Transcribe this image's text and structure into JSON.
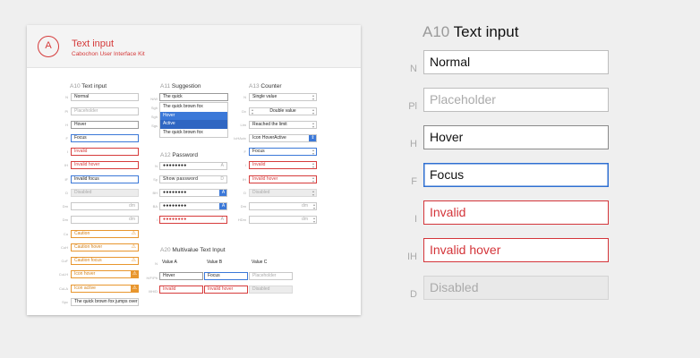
{
  "card": {
    "logo_letter": "A",
    "title": "Text input",
    "subtitle": "Cabochon User Interface Kit"
  },
  "a10": {
    "code": "A10",
    "title": "Text input",
    "rows": [
      {
        "label": "N",
        "value": "Normal",
        "state": "normal"
      },
      {
        "label": "Pl",
        "value": "Placeholder",
        "state": "ph"
      },
      {
        "label": "H",
        "value": "Hover",
        "state": "hover"
      },
      {
        "label": "F",
        "value": "Focus",
        "state": "focus"
      },
      {
        "label": "I",
        "value": "Invalid",
        "state": "invalid"
      },
      {
        "label": "IH",
        "value": "Invalid hover",
        "state": "invalid"
      },
      {
        "label": "IF",
        "value": "Invalid focus",
        "state": "focus"
      },
      {
        "label": "D",
        "value": "Disabled",
        "state": "disabled"
      },
      {
        "label": "Dm",
        "value": "",
        "suffix": "dm",
        "state": "normal"
      },
      {
        "label": "Dm",
        "value": "",
        "suffix": "dm",
        "state": "normal"
      },
      {
        "label": "Cu",
        "value": "Caution",
        "state": "caution",
        "icon": "warning-icon"
      },
      {
        "label": "CuH",
        "value": "Caution hover",
        "state": "caution",
        "icon": "warning-icon"
      },
      {
        "label": "CuF",
        "value": "Caution focus",
        "state": "caution-focus",
        "icon": "warning-icon"
      },
      {
        "label": "CuLH",
        "value": "Icon hover",
        "state": "caution",
        "icon": "warning-box-icon"
      },
      {
        "label": "CuLA",
        "value": "Icon active",
        "state": "caution",
        "icon": "warning-box-icon"
      },
      {
        "label": "Spc",
        "value": "The quick brown fox jumps over",
        "state": "normal"
      }
    ]
  },
  "a11": {
    "code": "A11",
    "title": "Suggestion",
    "labels": [
      "N/W",
      "Sgh",
      "Sgh",
      "Sgs"
    ],
    "input_value": "The quick",
    "suggestions": [
      {
        "text": "The quick brown fox",
        "state": "normal"
      },
      {
        "text": "Hover",
        "state": "hover"
      },
      {
        "text": "Active",
        "state": "active"
      },
      {
        "text": "The quick brown fox",
        "state": "normal"
      }
    ]
  },
  "a12": {
    "code": "A12",
    "title": "Password",
    "rows": [
      {
        "label": "N",
        "value": "●●●●●●●●",
        "state": "normal",
        "btn": "A"
      },
      {
        "label": "Sp",
        "value": "Show password",
        "state": "normal",
        "btn": "D"
      },
      {
        "label": "BH",
        "value": "●●●●●●●●",
        "state": "normal",
        "btn": "A",
        "btn_state": "blue"
      },
      {
        "label": "BA",
        "value": "●●●●●●●●",
        "state": "normal",
        "btn": "A",
        "btn_state": "blue"
      },
      {
        "label": "I",
        "value": "●●●●●●●●",
        "state": "invalid",
        "btn": "A"
      }
    ]
  },
  "a13": {
    "code": "A13",
    "title": "Counter",
    "rows": [
      {
        "label": "N",
        "value": "Single value",
        "state": "normal"
      },
      {
        "label": "Dv",
        "value": "Double value",
        "state": "normal",
        "centered": true
      },
      {
        "label": "Lim",
        "value": "Reached the limit",
        "state": "normal"
      },
      {
        "label": "IcHActv",
        "value": "Icon HoverActive",
        "state": "normal",
        "blue": true
      },
      {
        "label": "F",
        "value": "Focus",
        "state": "focus"
      },
      {
        "label": "I",
        "value": "Invalid",
        "state": "invalid"
      },
      {
        "label": "IH",
        "value": "Invalid hover",
        "state": "invalid"
      },
      {
        "label": "D",
        "value": "Disabled",
        "state": "disabled"
      },
      {
        "label": "Dm",
        "value": "",
        "suffix": "dm",
        "state": "normal"
      },
      {
        "label": "HDm",
        "value": "",
        "suffix": "dm",
        "state": "normal"
      }
    ]
  },
  "a20": {
    "code": "A20",
    "title": "Multivalue Text Input",
    "labels": [
      "N",
      "H/F/Ph",
      "I/IH/D"
    ],
    "header": [
      "Value A",
      "Value B",
      "Value C"
    ],
    "row1": [
      "Hover",
      "Focus",
      "Placeholder"
    ],
    "row2": [
      "Invalid",
      "Invalid hover",
      "Disabled"
    ]
  },
  "big": {
    "code": "A10",
    "title": "Text input",
    "rows": [
      {
        "label": "N",
        "value": "Normal",
        "state": "normal"
      },
      {
        "label": "Pl",
        "value": "Placeholder",
        "state": "ph"
      },
      {
        "label": "H",
        "value": "Hover",
        "state": "hover"
      },
      {
        "label": "F",
        "value": "Focus",
        "state": "focus"
      },
      {
        "label": "I",
        "value": "Invalid",
        "state": "invalid"
      },
      {
        "label": "IH",
        "value": "Invalid hover",
        "state": "invalid"
      },
      {
        "label": "D",
        "value": "Disabled",
        "state": "disabled"
      }
    ]
  },
  "colors": {
    "accent_red": "#d53a3a",
    "focus_blue": "#3b78d8",
    "caution_orange": "#e8962e"
  }
}
